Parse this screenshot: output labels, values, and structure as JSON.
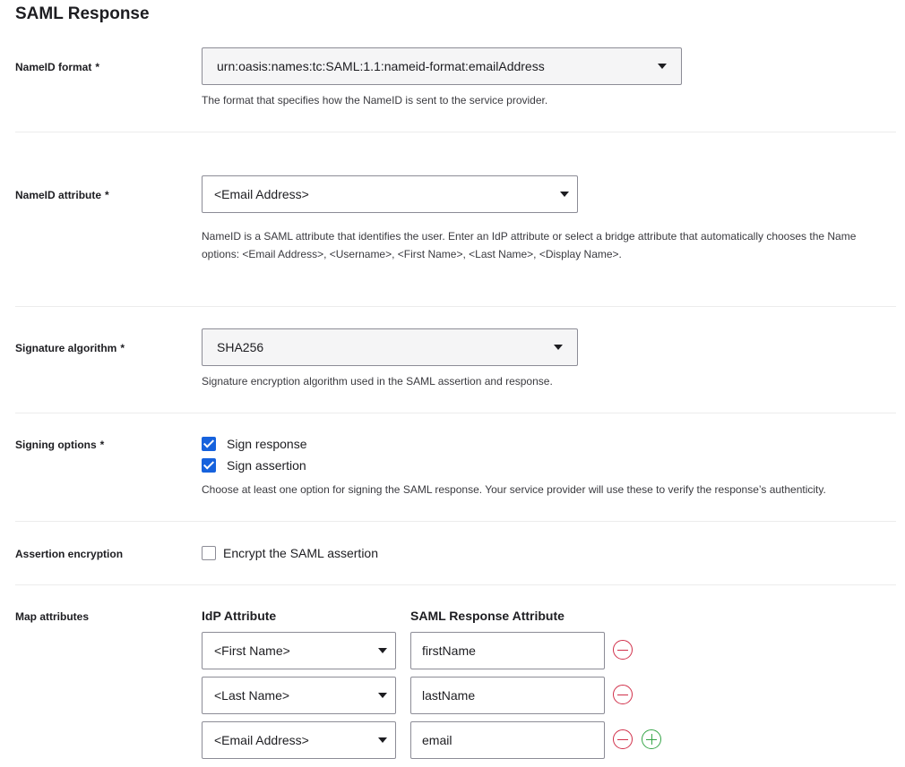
{
  "page": {
    "title": "SAML Response"
  },
  "required_marker": "*",
  "nameid_format": {
    "label": "NameID format",
    "value": "urn:oasis:names:tc:SAML:1.1:nameid-format:emailAddress",
    "help": "The format that specifies how the NameID is sent to the service provider."
  },
  "nameid_attribute": {
    "label": "NameID attribute",
    "value": "<Email Address>",
    "help_line1": "NameID is a SAML attribute that identifies the user. Enter an IdP attribute or select a bridge attribute that automatically chooses the Name",
    "help_line2": "options: <Email Address>, <Username>, <First Name>, <Last Name>, <Display Name>."
  },
  "signature_algorithm": {
    "label": "Signature algorithm",
    "value": "SHA256",
    "help": "Signature encryption algorithm used in the SAML assertion and response."
  },
  "signing_options": {
    "label": "Signing options",
    "options": [
      {
        "label": "Sign response",
        "checked": true
      },
      {
        "label": "Sign assertion",
        "checked": true
      }
    ],
    "help": "Choose at least one option for signing the SAML response. Your service provider will use these to verify the response’s authenticity."
  },
  "assertion_encryption": {
    "label": "Assertion encryption",
    "option": {
      "label": "Encrypt the SAML assertion",
      "checked": false
    }
  },
  "map_attributes": {
    "label": "Map attributes",
    "idp_header": "IdP Attribute",
    "saml_header": "SAML Response Attribute",
    "rows": [
      {
        "idp": "<First Name>",
        "saml": "firstName"
      },
      {
        "idp": "<Last Name>",
        "saml": "lastName"
      },
      {
        "idp": "<Email Address>",
        "saml": "email"
      }
    ]
  },
  "colors": {
    "accent": "#1662dd",
    "remove": "#d1304a",
    "add": "#36a548",
    "divider": "#ececec"
  },
  "icons": {
    "dropdown": "caret-down-icon",
    "remove": "minus-circle-icon",
    "add": "plus-circle-icon",
    "checked": "checkmark-icon"
  }
}
